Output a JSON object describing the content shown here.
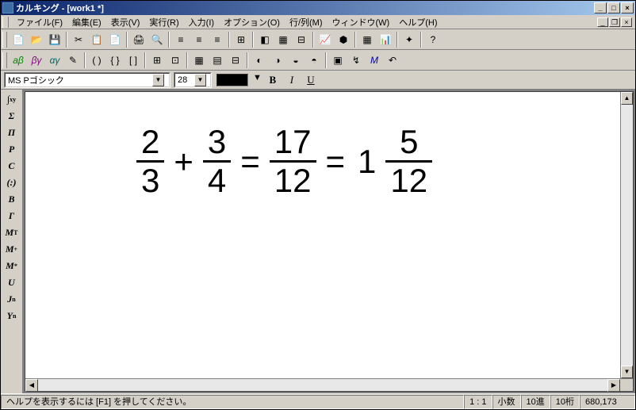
{
  "title": "カルキング - [work1 *]",
  "menu": [
    "ファイル(F)",
    "編集(E)",
    "表示(V)",
    "実行(R)",
    "入力(I)",
    "オプション(O)",
    "行/列(M)",
    "ウィンドウ(W)",
    "ヘルプ(H)"
  ],
  "font": {
    "name": "MS Pゴシック",
    "size": "28"
  },
  "style": {
    "bold": "B",
    "italic": "I",
    "underline": "U"
  },
  "vtools": [
    "∫",
    "Σ",
    "Π",
    "P",
    "C",
    "(:)",
    "B",
    "Γ",
    "Mᵀ",
    "M⁺",
    "M*",
    "U",
    "Jn",
    "Yn"
  ],
  "formula": {
    "f1n": "2",
    "f1d": "3",
    "op1": "+",
    "f2n": "3",
    "f2d": "4",
    "eq1": "=",
    "f3n": "17",
    "f3d": "12",
    "eq2": "=",
    "whole": "1",
    "f4n": "5",
    "f4d": "12"
  },
  "status": {
    "help": "ヘルプを表示するには [F1] を押してください。",
    "ratio": "1 : 1",
    "mode1": "小数",
    "mode2": "10進",
    "mode3": "10桁",
    "pos": "680,173"
  }
}
